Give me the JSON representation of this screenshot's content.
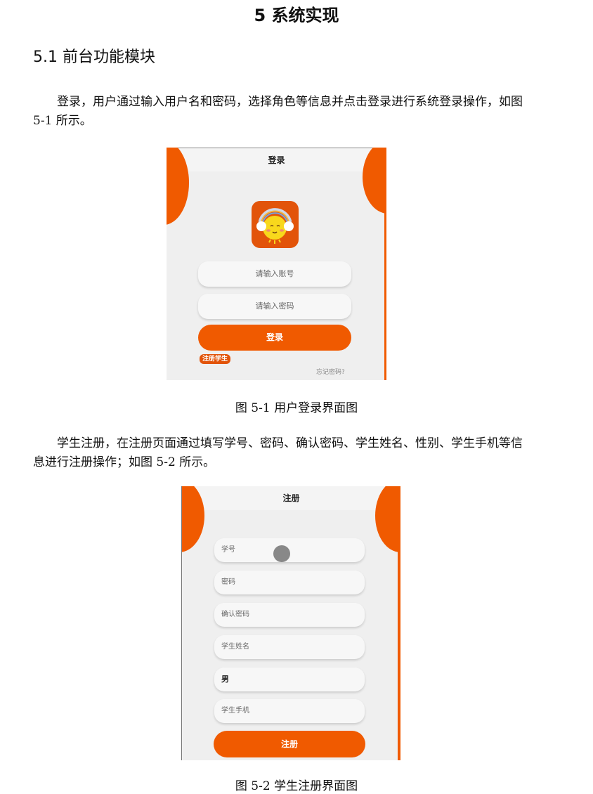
{
  "chapter": {
    "title": "5 系统实现"
  },
  "section": {
    "title": "5.1 前台功能模块"
  },
  "paragraphs": [
    "登录，用户通过输入用户名和密码，选择角色等信息并点击登录进行系统登录操作，如图 5-1 所示。",
    "学生注册，在注册页面通过填写学号、密码、确认密码、学生姓名、性别、学生手机等信息进行注册操作；如图 5-2 所示。"
  ],
  "figures": [
    {
      "caption": "图 5-1 用户登录界面图",
      "screen": {
        "header": "登录",
        "account_placeholder": "请输入账号",
        "password_placeholder": "请输入密码",
        "login_button": "登录",
        "register_link": "注册学生",
        "forgot_link": "忘记密码?"
      }
    },
    {
      "caption": "图 5-2 学生注册界面图",
      "screen": {
        "header": "注册",
        "back_icon": "chevron-left-icon",
        "fields": [
          "学号",
          "密码",
          "确认密码",
          "学生姓名",
          "男",
          "学生手机"
        ],
        "submit_button": "注册"
      }
    }
  ],
  "colors": {
    "accent": "#f05a00",
    "background": "#efefef"
  }
}
